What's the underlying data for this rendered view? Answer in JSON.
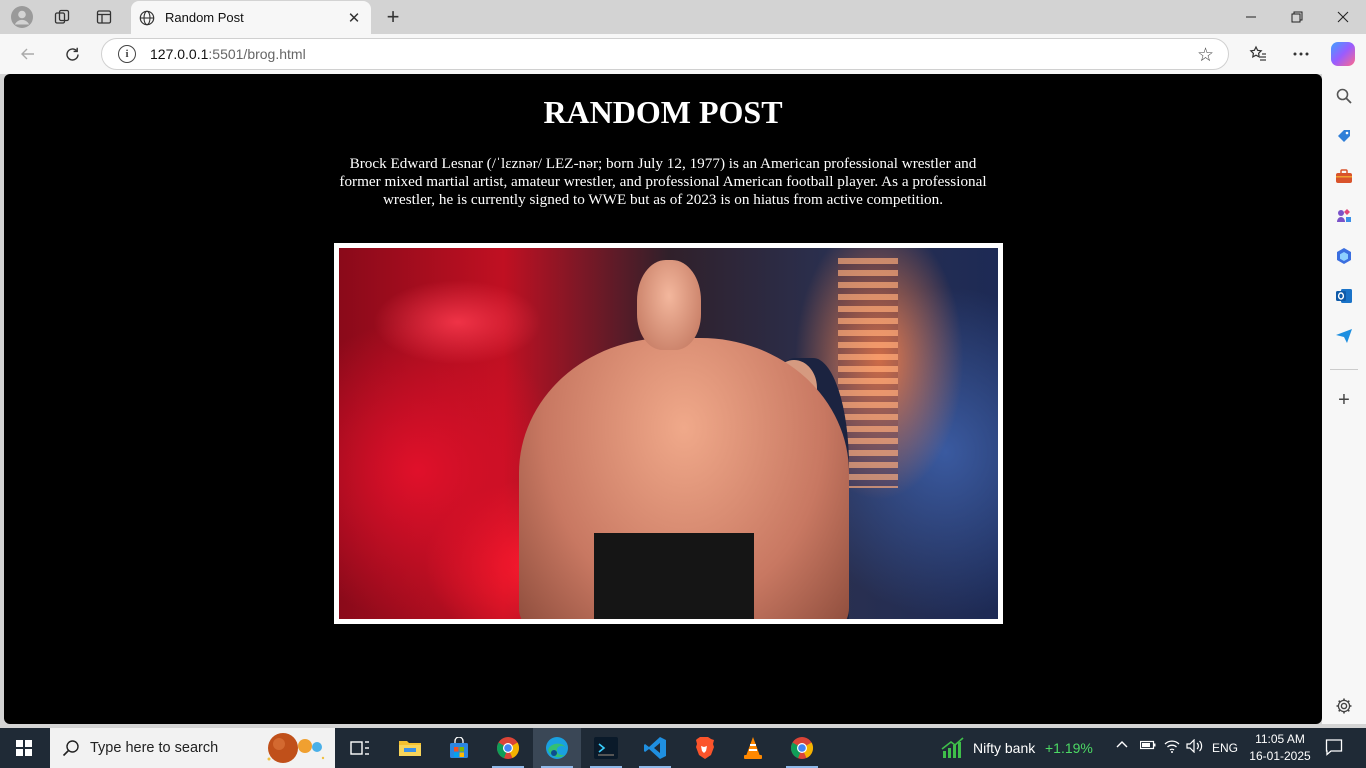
{
  "browser": {
    "tab_title": "Random Post",
    "url_host": "127.0.0.1",
    "url_rest": ":5501/brog.html"
  },
  "page": {
    "heading": "RANDOM POST",
    "paragraph": "Brock Edward Lesnar (/ˈlɛznər/ LEZ-nər; born July 12, 1977) is an American professional wrestler and former mixed martial artist, amateur wrestler, and professional American football player. As a professional wrestler, he is currently signed to WWE but as of 2023 is on hiatus from active competition."
  },
  "taskbar": {
    "search_placeholder": "Type here to search",
    "nifty_label": "Nifty bank",
    "nifty_change": "+1.19%",
    "language": "ENG",
    "time": "11:05 AM",
    "date": "16-01-2025"
  },
  "colors": {
    "page_bg": "#000000",
    "nifty_green": "#4cd964",
    "taskbar_bg": "#1f2a36"
  }
}
